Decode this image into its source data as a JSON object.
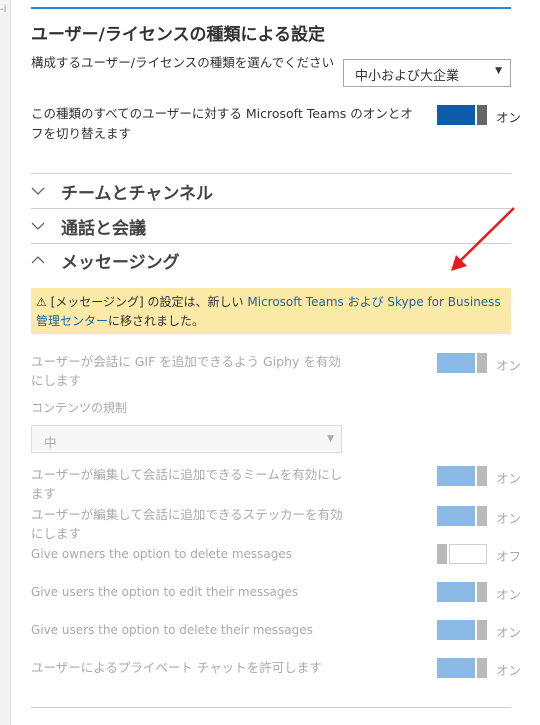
{
  "left_fragment": "-i",
  "settings_by_type": {
    "title": "ユーザー/ライセンスの種類による設定",
    "choose_label": "構成するユーザー/ライセンスの種類を選んでください",
    "selected_type": "中小および大企業",
    "master_label": "この種類のすべてのユーザーに対する Microsoft Teams のオンとオフを切り替えます",
    "master_state": "オン"
  },
  "sections": [
    {
      "label": "チームとチャンネル",
      "expanded": false
    },
    {
      "label": "通話と会議",
      "expanded": false
    },
    {
      "label": "メッセージング",
      "expanded": true
    }
  ],
  "notice": {
    "icon": "warning-icon",
    "icon_glyph": "⚠",
    "prefix": "[メッセージング] の設定は、新しい",
    "link_text": "Microsoft Teams および Skype for Business 管理センター",
    "suffix": "に移されました。"
  },
  "messaging": {
    "giphy_label": "ユーザーが会話に GIF を追加できるよう Giphy を有効にします",
    "giphy_state": "オン",
    "content_rating_label": "コンテンツの規制",
    "content_rating_value": "中",
    "memes_label": "ユーザーが編集して会話に追加できるミームを有効にします",
    "memes_state": "オン",
    "stickers_label": "ユーザーが編集して会話に追加できるステッカーを有効にします",
    "stickers_state": "オン",
    "owners_delete_label": "Give owners the option to delete messages",
    "owners_delete_state": "オフ",
    "users_edit_label": "Give users the option to edit their messages",
    "users_edit_state": "オン",
    "users_delete_label": "Give users the option to delete their messages",
    "users_delete_state": "オン",
    "private_chat_label": "ユーザーによるプライベート チャットを許可します",
    "private_chat_state": "オン"
  },
  "colors": {
    "toggle_on_dark": "#0f5da8",
    "toggle_on_disabled": "#8ab9e6",
    "notice_bg": "#fbe9a8",
    "link": "#1f63a8",
    "annotation_arrow": "#e8191b",
    "accent_line": "#2b88d8"
  }
}
